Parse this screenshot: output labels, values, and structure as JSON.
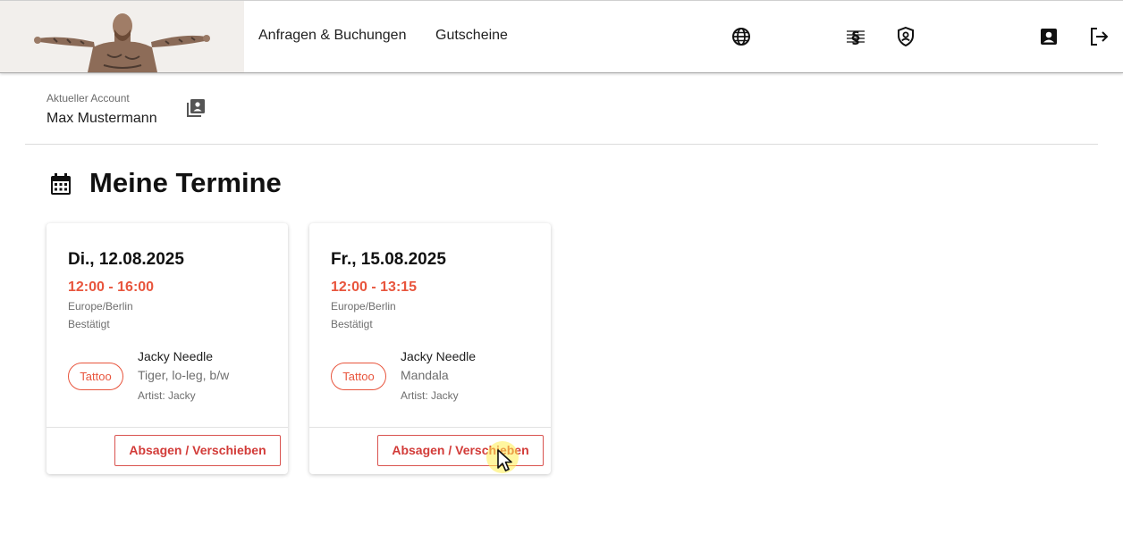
{
  "header": {
    "nav": [
      {
        "label": "Anfragen & Buchungen"
      },
      {
        "label": "Gutscheine"
      }
    ],
    "icons": [
      "globe-icon",
      "section-law-icon",
      "shield-user-icon",
      "account-box-icon",
      "logout-icon"
    ]
  },
  "account": {
    "label": "Aktueller Account",
    "name": "Max Mustermann"
  },
  "page": {
    "title": "Meine Termine"
  },
  "colors": {
    "accent": "#e8553d",
    "danger": "#d23b38"
  },
  "appointments": [
    {
      "date": "Di., 12.08.2025",
      "time": "12:00 - 16:00",
      "timezone": "Europe/Berlin",
      "status": "Bestätigt",
      "type": "Tattoo",
      "artist": "Jacky Needle",
      "motif": "Tiger, lo-leg, b/w",
      "artist_label": "Artist: Jacky",
      "action": "Absagen / Verschieben"
    },
    {
      "date": "Fr., 15.08.2025",
      "time": "12:00 - 13:15",
      "timezone": "Europe/Berlin",
      "status": "Bestätigt",
      "type": "Tattoo",
      "artist": "Jacky Needle",
      "motif": "Mandala",
      "artist_label": "Artist: Jacky",
      "action": "Absagen / Verschieben"
    }
  ]
}
